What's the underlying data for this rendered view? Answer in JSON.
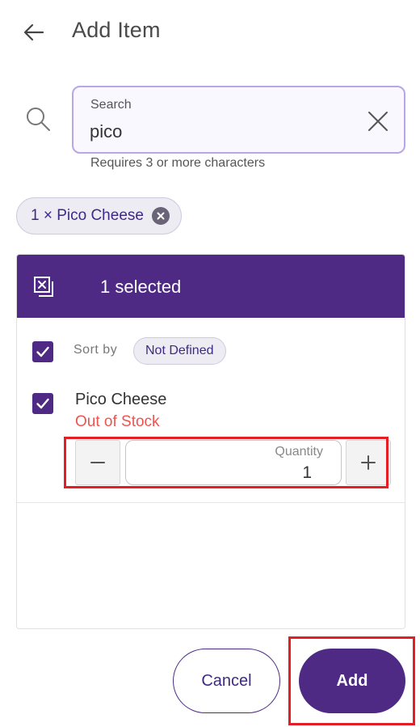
{
  "header": {
    "title": "Add Item",
    "back_icon": "arrow-left-icon"
  },
  "search": {
    "label": "Search",
    "value": "pico",
    "hint": "Requires 3 or more characters",
    "icon": "search-icon",
    "clear_icon": "close-icon"
  },
  "selected_chips": [
    {
      "label": "1 × Pico Cheese",
      "remove_icon": "cancel-circle-icon"
    }
  ],
  "panel": {
    "selected_count": "1 selected",
    "deselect_icon": "deselect-all-icon",
    "sort_label": "Sort by",
    "sort_value": "Not Defined",
    "items": [
      {
        "name": "Pico Cheese",
        "status": "Out of Stock",
        "checked": true,
        "quantity_label": "Quantity",
        "quantity": "1"
      }
    ]
  },
  "footer": {
    "cancel_label": "Cancel",
    "add_label": "Add"
  },
  "colors": {
    "primary": "#4e2a84",
    "error": "#ef5350",
    "highlight": "#e31e24",
    "input_border": "#b8a6e6"
  }
}
